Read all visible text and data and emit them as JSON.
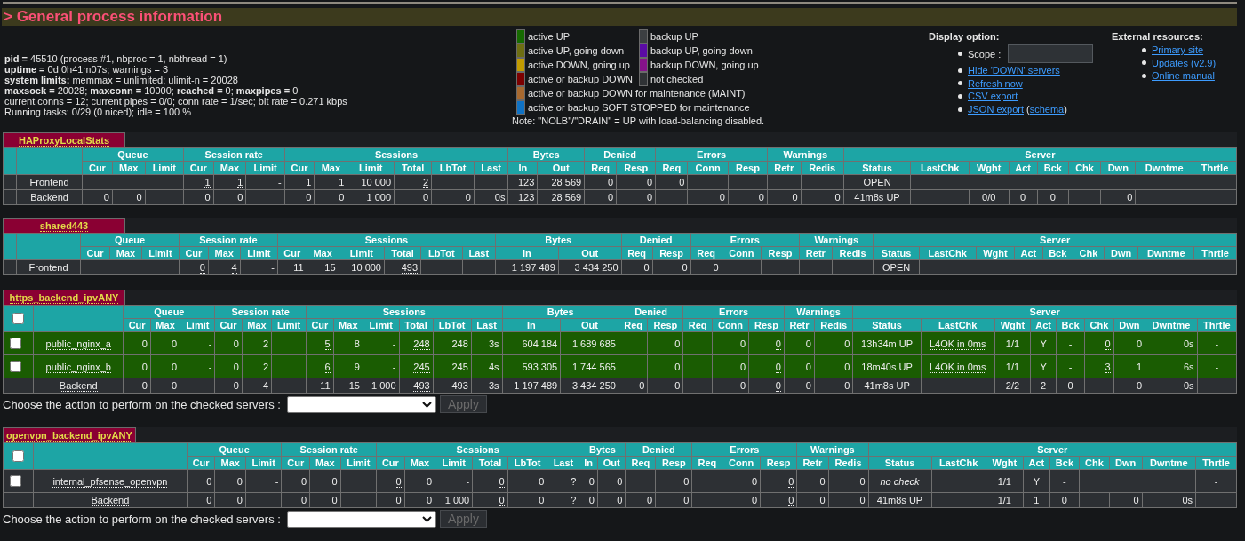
{
  "header": {
    "title": "> General process information"
  },
  "process_info": [
    "**pid =** 45510 (process #1, nbproc = 1, nbthread = 1)",
    "**uptime =** 0d 0h41m07s; warnings = 3",
    "**system limits:** memmax = unlimited; ulimit-n = 20028",
    "**maxsock =** 20028; **maxconn =** 10000; **reached =** 0; **maxpipes =** 0",
    "current conns = 12; current pipes = 0/0; conn rate = 1/sec; bit rate = 0.271 kbps",
    "Running tasks: 0/29 (0 niced); idle = 100 %"
  ],
  "legend": {
    "rows": [
      [
        {
          "label": "active UP",
          "color": "#166a00"
        },
        {
          "label": "backup UP",
          "color": "#3c3f42"
        }
      ],
      [
        {
          "label": "active UP, going down",
          "color": "#6e6e12"
        },
        {
          "label": "backup UP, going down",
          "color": "#5b0ba5"
        }
      ],
      [
        {
          "label": "active DOWN, going up",
          "color": "#c29b00"
        },
        {
          "label": "backup DOWN, going up",
          "color": "#86128a"
        }
      ],
      [
        {
          "label": "active or backup DOWN",
          "color": "#7c0000"
        },
        {
          "label": "not checked",
          "color": "#2f3235"
        }
      ],
      [
        {
          "label": "active or backup DOWN for maintenance (MAINT)",
          "color": "#a8692f"
        }
      ],
      [
        {
          "label": "active or backup SOFT STOPPED for maintenance",
          "color": "#0f72c4"
        }
      ]
    ],
    "note": "Note: \"NOLB\"/\"DRAIN\" = UP with load-balancing disabled."
  },
  "display_options": {
    "title": "Display option:",
    "scope": {
      "label": "Scope :"
    },
    "links": [
      {
        "label": "Hide 'DOWN' servers"
      },
      {
        "label": "Refresh now"
      },
      {
        "label": "CSV export"
      },
      {
        "label": "JSON export",
        "aside": {
          "open": "(",
          "label": "schema",
          "close": ")"
        }
      }
    ]
  },
  "external_resources": {
    "title": "External resources:",
    "links": [
      "Primary site",
      "Updates (v2.9)",
      "Online manual"
    ]
  },
  "proxies": [
    {
      "name": "HAProxyLocalStats",
      "columns": [
        {
          "group": "Queue",
          "colspan": 3,
          "columns": [
            "Cur",
            "Max",
            "Limit"
          ]
        },
        {
          "group": "Session rate",
          "colspan": 3,
          "columns": [
            "Cur",
            "Max",
            "Limit"
          ]
        },
        {
          "group": "Sessions",
          "colspan": 6,
          "columns": [
            "Cur",
            "Max",
            "Limit",
            "Total",
            "LbTot",
            "Last"
          ]
        },
        {
          "group": "Bytes",
          "colspan": 2,
          "columns": [
            "In",
            "Out"
          ]
        },
        {
          "group": "Denied",
          "colspan": 2,
          "columns": [
            "Req",
            "Resp"
          ]
        },
        {
          "group": "Errors",
          "colspan": 3,
          "columns": [
            "Req",
            "Conn",
            "Resp"
          ]
        },
        {
          "group": "Warnings",
          "colspan": 2,
          "columns": [
            "Retr",
            "Redis"
          ]
        },
        {
          "group": "Server",
          "colspan": 9,
          "columns": [
            "Status",
            "LastChk",
            "Wght",
            "Act",
            "Bck",
            "Chk",
            "Dwn",
            "Dwntme",
            "Thrtle"
          ]
        }
      ],
      "rows": [
        {
          "name": "Frontend",
          "cells": [
            {
              "colspan": 3
            },
            {
              "text": "1",
              "tooltip": true
            },
            {
              "text": "1",
              "tooltip": true
            },
            "-",
            "1",
            "1",
            "10 000",
            {
              "text": "2",
              "tooltip": true
            },
            null,
            null,
            "123",
            "28 569",
            "0",
            "0",
            "0",
            null,
            null,
            null,
            null,
            "OPEN",
            {
              "colspan": 8
            }
          ]
        },
        {
          "name": {
            "text": "Backend",
            "tooltip": true
          },
          "cells": [
            "0",
            "0",
            null,
            "0",
            "0",
            null,
            "0",
            "0",
            "1 000",
            {
              "text": "0",
              "tooltip": true
            },
            "0",
            "0s",
            "123",
            "28 569",
            "0",
            "0",
            null,
            "0",
            {
              "text": "0",
              "tooltip": true
            },
            "0",
            "0",
            "41m8s UP",
            null,
            "0/0",
            "0",
            "0",
            null,
            "0",
            null,
            null
          ]
        }
      ]
    },
    {
      "name": "shared443",
      "columns": [
        {
          "group": "Queue",
          "colspan": 3,
          "columns": [
            "Cur",
            "Max",
            "Limit"
          ]
        },
        {
          "group": "Session rate",
          "colspan": 3,
          "columns": [
            "Cur",
            "Max",
            "Limit"
          ]
        },
        {
          "group": "Sessions",
          "colspan": 6,
          "columns": [
            "Cur",
            "Max",
            "Limit",
            "Total",
            "LbTot",
            "Last"
          ]
        },
        {
          "group": "Bytes",
          "colspan": 2,
          "columns": [
            "In",
            "Out"
          ]
        },
        {
          "group": "Denied",
          "colspan": 2,
          "columns": [
            "Req",
            "Resp"
          ]
        },
        {
          "group": "Errors",
          "colspan": 3,
          "columns": [
            "Req",
            "Conn",
            "Resp"
          ]
        },
        {
          "group": "Warnings",
          "colspan": 2,
          "columns": [
            "Retr",
            "Redis"
          ]
        },
        {
          "group": "Server",
          "colspan": 9,
          "columns": [
            "Status",
            "LastChk",
            "Wght",
            "Act",
            "Bck",
            "Chk",
            "Dwn",
            "Dwntme",
            "Thrtle"
          ]
        }
      ],
      "rows": [
        {
          "name": "Frontend",
          "cells": [
            {
              "colspan": 3
            },
            {
              "text": "0",
              "tooltip": true
            },
            {
              "text": "4",
              "tooltip": true
            },
            "-",
            "11",
            "15",
            "10 000",
            {
              "text": "493",
              "tooltip": true
            },
            null,
            null,
            "1 197 489",
            "3 434 250",
            "0",
            "0",
            "0",
            null,
            null,
            null,
            null,
            "OPEN",
            {
              "colspan": 8
            }
          ]
        }
      ]
    },
    {
      "name": "https_backend_ipvANY",
      "select_all": {
        "checked": false
      },
      "columns": [
        {
          "group": "Queue",
          "colspan": 3,
          "columns": [
            "Cur",
            "Max",
            "Limit"
          ]
        },
        {
          "group": "Session rate",
          "colspan": 3,
          "columns": [
            "Cur",
            "Max",
            "Limit"
          ]
        },
        {
          "group": "Sessions",
          "colspan": 6,
          "columns": [
            "Cur",
            "Max",
            "Limit",
            "Total",
            "LbTot",
            "Last"
          ]
        },
        {
          "group": "Bytes",
          "colspan": 2,
          "columns": [
            "In",
            "Out"
          ]
        },
        {
          "group": "Denied",
          "colspan": 2,
          "columns": [
            "Req",
            "Resp"
          ]
        },
        {
          "group": "Errors",
          "colspan": 3,
          "columns": [
            "Req",
            "Conn",
            "Resp"
          ]
        },
        {
          "group": "Warnings",
          "colspan": 2,
          "columns": [
            "Retr",
            "Redis"
          ]
        },
        {
          "group": "Server",
          "colspan": 9,
          "columns": [
            "Status",
            "LastChk",
            "Wght",
            "Act",
            "Bck",
            "Chk",
            "Dwn",
            "Dwntme",
            "Thrtle"
          ]
        }
      ],
      "rows": [
        {
          "name": {
            "text": "public_nginx_a",
            "tooltip": true
          },
          "checked": false,
          "color": "#1a5c02",
          "cells": [
            "0",
            "0",
            "-",
            "0",
            "2",
            null,
            {
              "text": "5",
              "tooltip": true
            },
            "8",
            "-",
            {
              "text": "248",
              "tooltip": true
            },
            "248",
            "3s",
            "604 184",
            "1 689 685",
            null,
            "0",
            null,
            "0",
            {
              "text": "0",
              "tooltip": true
            },
            "0",
            "0",
            "13h34m UP",
            {
              "text": "L4OK in 0ms",
              "tooltip": true
            },
            "1/1",
            "Y",
            "-",
            {
              "text": "0",
              "tooltip": true
            },
            "0",
            "0s",
            "-"
          ]
        },
        {
          "name": {
            "text": "public_nginx_b",
            "tooltip": true
          },
          "checked": false,
          "color": "#1a5c02",
          "cells": [
            "0",
            "0",
            "-",
            "0",
            "2",
            null,
            {
              "text": "6",
              "tooltip": true
            },
            "9",
            "-",
            {
              "text": "245",
              "tooltip": true
            },
            "245",
            "4s",
            "593 305",
            "1 744 565",
            null,
            "0",
            null,
            "0",
            {
              "text": "0",
              "tooltip": true
            },
            "0",
            "0",
            "18m40s UP",
            {
              "text": "L4OK in 0ms",
              "tooltip": true
            },
            "1/1",
            "Y",
            "-",
            {
              "text": "3",
              "tooltip": true
            },
            "1",
            "6s",
            "-"
          ]
        },
        {
          "name": {
            "text": "Backend",
            "tooltip": true
          },
          "cells": [
            "0",
            "0",
            null,
            "0",
            "4",
            null,
            "11",
            "15",
            "1 000",
            {
              "text": "493",
              "tooltip": true
            },
            "493",
            "3s",
            "1 197 489",
            "3 434 250",
            "0",
            "0",
            null,
            "0",
            {
              "text": "0",
              "tooltip": true
            },
            "0",
            "0",
            "41m8s UP",
            null,
            "2/2",
            "2",
            "0",
            null,
            "0",
            "0s",
            null
          ]
        }
      ],
      "action": {
        "label": "Choose the action to perform on the checked servers :",
        "button": "Apply"
      }
    },
    {
      "name": "openvpn_backend_ipvANY",
      "select_all": {
        "checked": false
      },
      "columns": [
        {
          "group": "Queue",
          "colspan": 3,
          "columns": [
            "Cur",
            "Max",
            "Limit"
          ]
        },
        {
          "group": "Session rate",
          "colspan": 3,
          "columns": [
            "Cur",
            "Max",
            "Limit"
          ]
        },
        {
          "group": "Sessions",
          "colspan": 6,
          "columns": [
            "Cur",
            "Max",
            "Limit",
            "Total",
            "LbTot",
            "Last"
          ]
        },
        {
          "group": "Bytes",
          "colspan": 2,
          "columns": [
            "In",
            "Out"
          ]
        },
        {
          "group": "Denied",
          "colspan": 2,
          "columns": [
            "Req",
            "Resp"
          ]
        },
        {
          "group": "Errors",
          "colspan": 3,
          "columns": [
            "Req",
            "Conn",
            "Resp"
          ]
        },
        {
          "group": "Warnings",
          "colspan": 2,
          "columns": [
            "Retr",
            "Redis"
          ]
        },
        {
          "group": "Server",
          "colspan": 9,
          "columns": [
            "Status",
            "LastChk",
            "Wght",
            "Act",
            "Bck",
            "Chk",
            "Dwn",
            "Dwntme",
            "Thrtle"
          ]
        }
      ],
      "rows": [
        {
          "name": {
            "text": "internal_pfsense_openvpn",
            "tooltip": true
          },
          "checked": false,
          "color": "#2d3034",
          "cells": [
            "0",
            "0",
            "-",
            "0",
            "0",
            null,
            {
              "text": "0",
              "tooltip": true
            },
            "0",
            "-",
            {
              "text": "0",
              "tooltip": true
            },
            "0",
            "?",
            "0",
            "0",
            null,
            "0",
            null,
            "0",
            {
              "text": "0",
              "tooltip": true
            },
            "0",
            "0",
            {
              "text": "no check",
              "italic": true
            },
            null,
            "1/1",
            "Y",
            "-",
            {
              "colspan": 3
            },
            "-"
          ]
        },
        {
          "name": {
            "text": "Backend",
            "tooltip": true
          },
          "cells": [
            "0",
            "0",
            null,
            "0",
            "0",
            null,
            "0",
            "0",
            "1 000",
            {
              "text": "0",
              "tooltip": true
            },
            "0",
            "?",
            "0",
            "0",
            "0",
            "0",
            null,
            "0",
            {
              "text": "0",
              "tooltip": true
            },
            "0",
            "0",
            "41m8s UP",
            null,
            "1/1",
            "1",
            "0",
            null,
            "0",
            "0s",
            null
          ]
        }
      ],
      "action": {
        "label": "Choose the action to perform on the checked servers :",
        "button": "Apply"
      }
    }
  ]
}
